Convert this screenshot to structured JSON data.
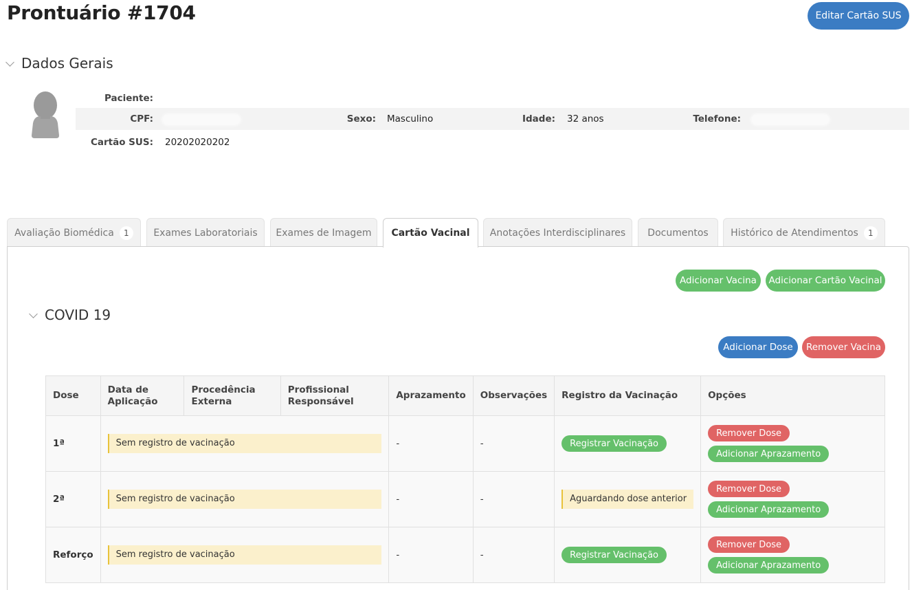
{
  "header": {
    "title": "Prontuário #1704",
    "edit_sus_label": "Editar Cartão SUS"
  },
  "general": {
    "section_label": "Dados Gerais",
    "patient_label": "Paciente:",
    "cpf_label": "CPF:",
    "sex_label": "Sexo:",
    "sex_value": "Masculino",
    "age_label": "Idade:",
    "age_value": "32 anos",
    "phone_label": "Telefone:",
    "sus_label": "Cartão SUS:",
    "sus_value": "20202020202"
  },
  "tabs": [
    {
      "label": "Avaliação Biomédica",
      "badge": "1"
    },
    {
      "label": "Exames Laboratoriais"
    },
    {
      "label": "Exames de Imagem"
    },
    {
      "label": "Cartão Vacinal",
      "active": true
    },
    {
      "label": "Anotações Interdisciplinares"
    },
    {
      "label": "Documentos"
    },
    {
      "label": "Histórico de Atendimentos",
      "badge": "1"
    }
  ],
  "actions": {
    "add_vaccine": "Adicionar Vacina",
    "add_card": "Adicionar Cartão Vacinal"
  },
  "vaccine": {
    "name": "COVID 19",
    "add_dose": "Adicionar Dose",
    "remove_vaccine": "Remover Vacina",
    "columns": {
      "dose": "Dose",
      "date": "Data de Aplicação",
      "external": "Procedência Externa",
      "professional": "Profissional Responsável",
      "schedule": "Aprazamento",
      "notes": "Observações",
      "record": "Registro da Vacinação",
      "options": "Opções"
    },
    "rows": [
      {
        "dose": "1ª",
        "status": "Sem registro de vacinação",
        "schedule": "-",
        "notes": "-",
        "record": "Registrar Vacinação",
        "remove": "Remover Dose",
        "add_schedule": "Adicionar Aprazamento"
      },
      {
        "dose": "2ª",
        "status": "Sem registro de vacinação",
        "schedule": "-",
        "notes": "-",
        "record": "Aguardando dose anterior",
        "remove": "Remover Dose",
        "add_schedule": "Adicionar Aprazamento"
      },
      {
        "dose": "Reforço",
        "status": "Sem registro de vacinação",
        "schedule": "-",
        "notes": "-",
        "record": "Registrar Vacinação",
        "remove": "Remover Dose",
        "add_schedule": "Adicionar Aprazamento"
      }
    ]
  }
}
